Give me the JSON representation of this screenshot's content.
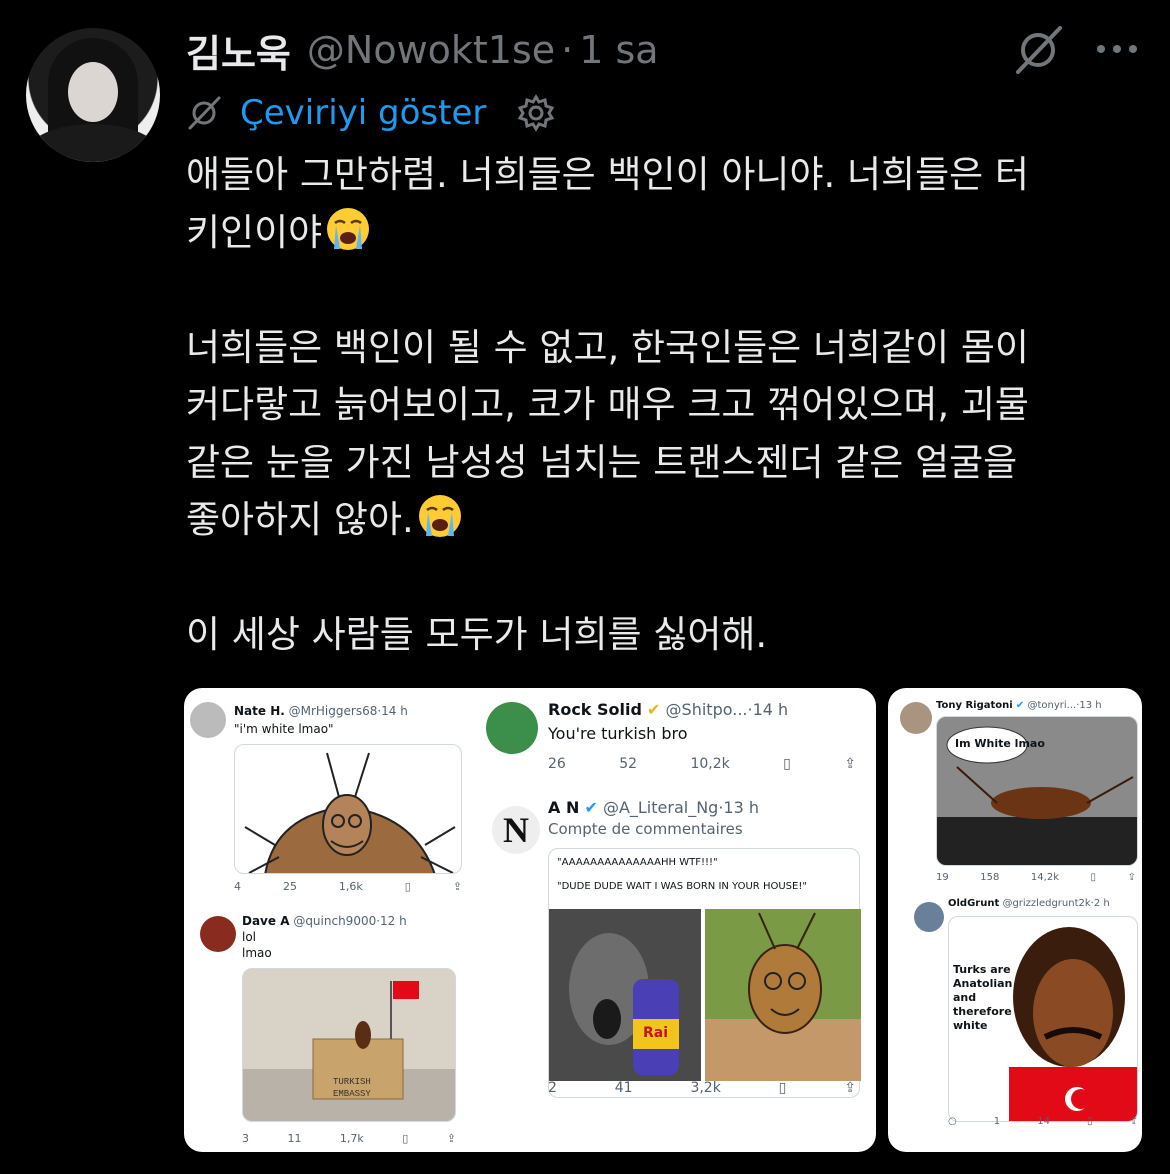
{
  "tweet": {
    "display_name": "김노욱",
    "handle": "@Nowokt1se",
    "separator": "·",
    "time": "1 sa",
    "translate_label": "Çeviriyi göster",
    "paragraphs": [
      [
        "애들아 그만하렴. 너희들은 백인이 아니야. 너희들은 터",
        "키인이야"
      ],
      [
        "너희들은 백인이 될 수 없고, 한국인들은 너희같이 몸이",
        "커다랗고 늙어보이고, 코가 매우 크고 꺾어있으며, 괴물",
        "같은 눈을 가진 남성성 넘치는 트랜스젠더 같은 얼굴을",
        "좋아하지 않아."
      ],
      [
        "이 세상 사람들 모두가 너희를 싫어해."
      ]
    ],
    "emoji": "loudly-crying-face"
  },
  "media": {
    "nate": {
      "name": "Nate H.",
      "handle": "@MrHiggers68",
      "time": "14 h",
      "text": "\"i'm white lmao\"",
      "replies": "4",
      "retweets": "25",
      "likes": "1,6k"
    },
    "rock": {
      "name": "Rock Solid",
      "handle": "@Shitpo...",
      "time": "14 h",
      "text": "You're turkish bro",
      "replies": "26",
      "retweets": "52",
      "likes": "10,2k"
    },
    "an": {
      "name": "A N",
      "handle": "@A_Literal_Ng",
      "time": "13 h",
      "subtitle": "Compte de commentaires",
      "quote1": "\"AAAAAAAAAAAAAAHH WTF!!!\"",
      "quote2": "\"DUDE DUDE WAIT I WAS BORN IN YOUR HOUSE!\"",
      "replies": "2",
      "retweets": "41",
      "likes": "3,2k",
      "can_label": "Rai"
    },
    "dave": {
      "name": "Dave A",
      "handle": "@quinch9000",
      "time": "12 h",
      "line1": "lol",
      "line2": "lmao",
      "box_label_1": "TURKISH",
      "box_label_2": "EMBASSY",
      "replies": "3",
      "retweets": "11",
      "likes": "1,7k"
    },
    "tony": {
      "name": "Tony Rigatoni",
      "handle": "@tonyri...",
      "time": "13 h",
      "bubble": "Im White lmao",
      "replies": "19",
      "retweets": "158",
      "likes": "14,2k"
    },
    "old": {
      "name": "OldGrunt",
      "handle": "@grizzledgrunt2k",
      "time": "2 h",
      "caption_lines": [
        "Turks are",
        "Anatolian",
        "and",
        "therefore",
        "white"
      ],
      "replies": "",
      "retweets": "1",
      "likes": "14"
    }
  },
  "colors": {
    "background": "#000000",
    "text": "#e7e9ea",
    "muted": "#71767b",
    "link": "#1d9bf0",
    "verified": "#1d9bf0",
    "gold_badge": "#e2b719"
  }
}
